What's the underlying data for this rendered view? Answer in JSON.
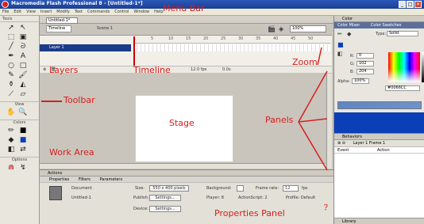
{
  "window": {
    "title": "Macromedia Flash Professional 8 - [Untitled-1*]",
    "buttons": [
      "_",
      "□",
      "✕"
    ]
  },
  "menubar": {
    "items": [
      "File",
      "Edit",
      "View",
      "Insert",
      "Modify",
      "Text",
      "Commands",
      "Control",
      "Window",
      "Help"
    ]
  },
  "tools": {
    "header": "Tools",
    "view_label": "View",
    "colors_label": "Colors",
    "options_label": "Options"
  },
  "document": {
    "tab": "Untitled-1*",
    "timeline_tab": "Timeline",
    "scene": "Scene 1",
    "zoom_value": "100%",
    "layer_name": "Layer 1",
    "frame_numbers": [
      "1",
      "5",
      "10",
      "15",
      "20",
      "25",
      "30",
      "35",
      "40",
      "45",
      "50"
    ],
    "fps": "12.0 fps",
    "time": "0.0s"
  },
  "properties": {
    "header": "Actions",
    "tabs": [
      "Properties",
      "Filters",
      "Parameters"
    ],
    "doc_type": "Document",
    "doc_name": "Untitled-1",
    "size_label": "Size:",
    "size_value": "550 x 400 pixels",
    "bg_label": "Background:",
    "framerate_label": "Frame rate:",
    "framerate_value": "12",
    "fps_unit": "fps",
    "publish_label": "Publish:",
    "settings_label": "Settings...",
    "player_text": "Player: 8",
    "actionscript_text": "ActionScript: 2",
    "profile_text": "Profile: Default",
    "device_label": "Device:"
  },
  "color_panel": {
    "header": "Color",
    "tabs": [
      "Color Mixer",
      "Color Swatches"
    ],
    "type_label": "Type:",
    "type_value": "Solid",
    "r_label": "R:",
    "r_value": "0",
    "g_label": "G:",
    "g_value": "102",
    "b_label": "B:",
    "b_value": "204",
    "alpha_label": "Alpha:",
    "alpha_value": "100%",
    "hex_value": "#0066CC"
  },
  "behaviors_panel": {
    "header": "Behaviors",
    "layer_text": "Layer 1 Frame 1",
    "col_event": "Event",
    "col_action": "Action"
  },
  "library_panel": {
    "header": "Library"
  },
  "annotations": {
    "menu_bar": "Menu Bar",
    "layers": "Layers",
    "timeline": "Timeline",
    "zoom": "Zoom",
    "toolbar": "Toolbar",
    "stage": "Stage",
    "panels": "Panels",
    "work_area": "Work Area",
    "properties_panel": "Properties Panel"
  }
}
